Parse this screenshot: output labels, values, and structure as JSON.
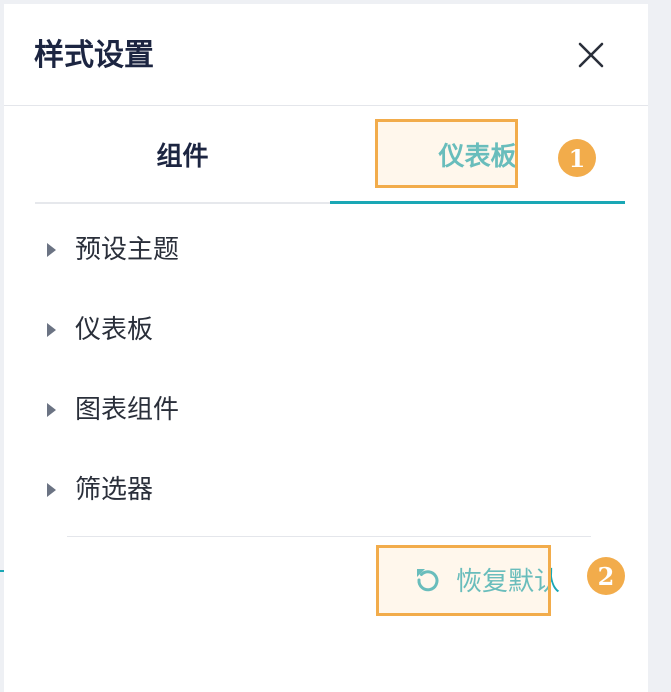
{
  "panel": {
    "title": "样式设置",
    "close_icon": "close-icon"
  },
  "tabs": [
    {
      "label": "组件",
      "active": false
    },
    {
      "label": "仪表板",
      "active": true
    }
  ],
  "sections": [
    {
      "label": "预设主题",
      "icon": "caret-right-icon"
    },
    {
      "label": "仪表板",
      "icon": "caret-right-icon"
    },
    {
      "label": "图表组件",
      "icon": "caret-right-icon"
    },
    {
      "label": "筛选器",
      "icon": "caret-right-icon"
    }
  ],
  "reset": {
    "label": "恢复默认",
    "icon": "refresh-icon"
  },
  "annotations": {
    "badge_1": "1",
    "badge_2": "2"
  },
  "colors": {
    "accent": "#1aa7b5",
    "highlight": "#f2ac4b",
    "title": "#1c2541"
  }
}
